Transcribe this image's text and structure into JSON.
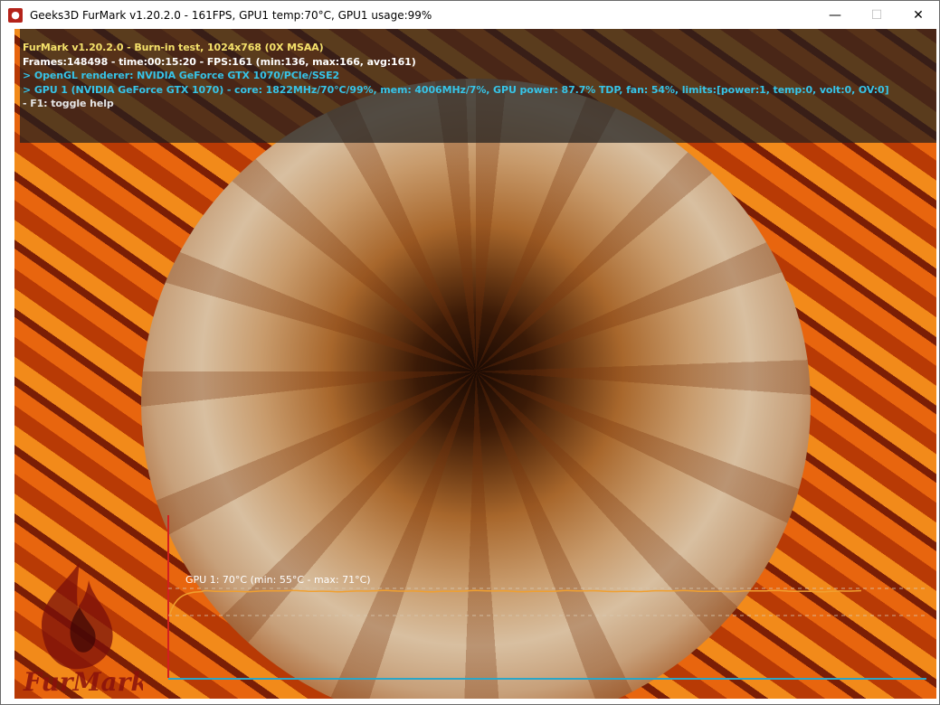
{
  "window": {
    "title": "Geeks3D FurMark v1.20.2.0 - 161FPS, GPU1 temp:70°C, GPU1 usage:99%",
    "icon": "furmark-flame-icon",
    "minimize": "—",
    "maximize": "☐",
    "close": "✕"
  },
  "hud": {
    "line1": "FurMark v1.20.2.0 - Burn-in test, 1024x768 (0X MSAA)",
    "line2": "Frames:148498 - time:00:15:20 - FPS:161 (min:136, max:166, avg:161)",
    "line3": "> OpenGL renderer: NVIDIA GeForce GTX 1070/PCIe/SSE2",
    "line4": "> GPU 1 (NVIDIA GeForce GTX 1070) - core: 1822MHz/70°C/99%, mem: 4006MHz/7%, GPU power: 87.7% TDP, fan: 54%, limits:[power:1, temp:0, volt:0, OV:0]",
    "line5": "- F1: toggle help"
  },
  "temperature_graph": {
    "label": "GPU 1: 70°C (min: 55°C - max: 71°C)",
    "current": 70,
    "min": 55,
    "max": 71,
    "unit": "°C",
    "line_color": "#f0a030",
    "axis_color": "#2aa6c8",
    "vertical_axis_color": "#d21f1f"
  },
  "logo": {
    "text": "FurMark"
  },
  "colors": {
    "hud_title": "#f5e26b",
    "hud_stats": "#ffffff",
    "hud_gpu_info": "#36c4e8",
    "hud_help": "#e6e6e6"
  }
}
